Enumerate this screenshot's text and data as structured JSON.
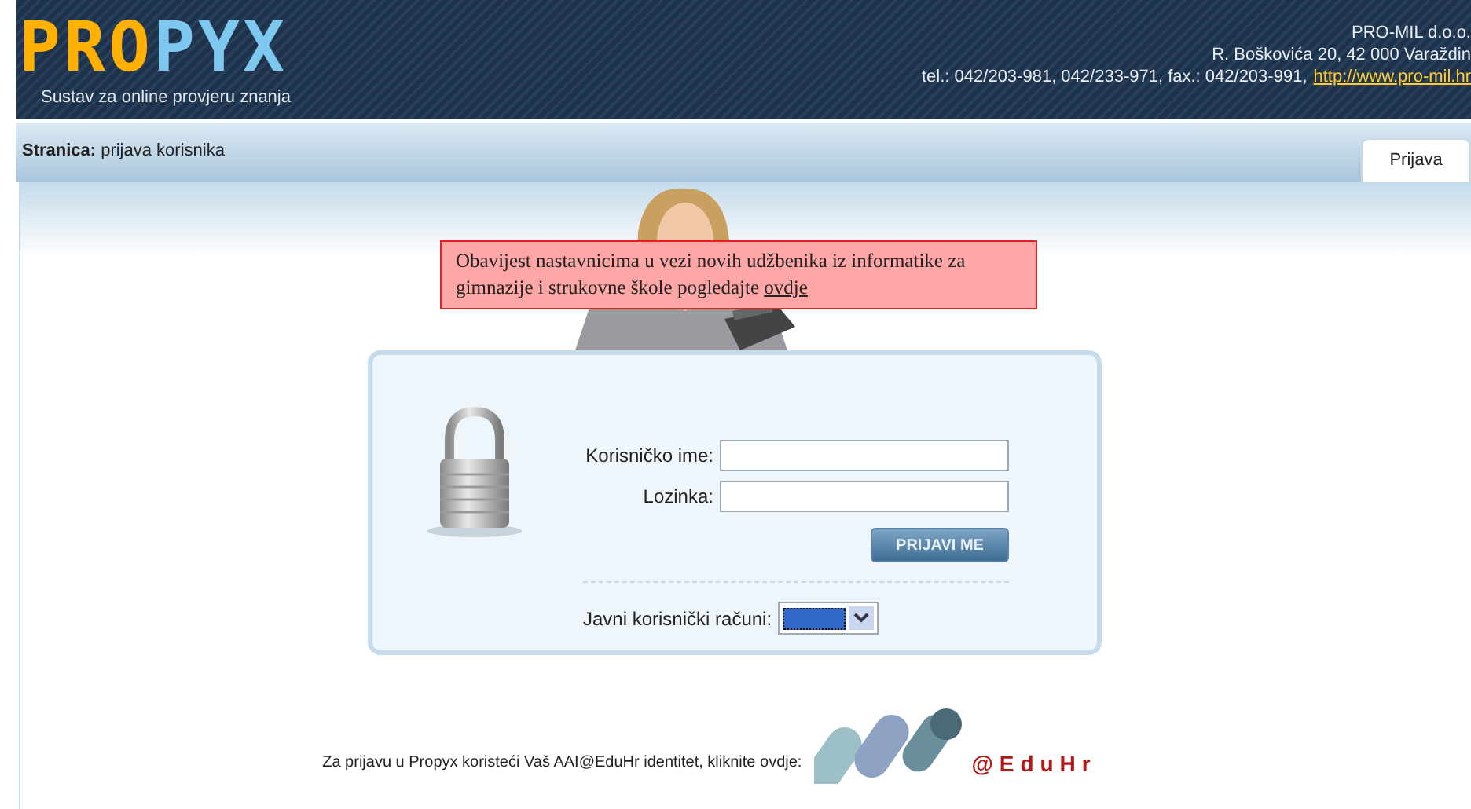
{
  "header": {
    "logo": {
      "part_1": "PRO",
      "part_2": "PYX"
    },
    "tagline": "Sustav za online provjeru znanja",
    "company": "PRO-MIL d.o.o.",
    "address": "R. Boškovića 20, 42 000 Varaždin",
    "contact": "tel.: 042/203-981, 042/233-971, fax.: 042/203-991,",
    "website": "http://www.pro-mil.hr"
  },
  "breadcrumb": {
    "label": "Stranica:",
    "page": "prijava korisnika"
  },
  "tabs": [
    {
      "label": "Prijava",
      "selected": true
    }
  ],
  "notice": {
    "text": "Obavijest nastavnicima u vezi novih udžbenika iz informatike za gimnazije i strukovne škole pogledajte",
    "link": "ovdje"
  },
  "login": {
    "username_label": "Korisničko ime:",
    "password_label": "Lozinka:",
    "submit": "PRIJAVI ME",
    "public_accounts_label": "Javni korisnički računi:"
  },
  "aai": {
    "text": "Za prijavu u Propyx koristeći Vaš AAI@EduHr identitet, kliknite ovdje:",
    "logo_text": "@EduHr"
  }
}
